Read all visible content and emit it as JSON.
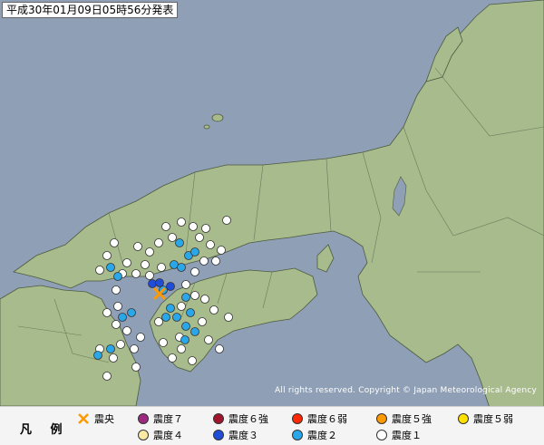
{
  "header": {
    "title": "平成30年01月09日05時56分発表"
  },
  "copyright": "All rights reserved. Copyright © Japan Meteorological Agency",
  "legend": {
    "title": "凡 例",
    "epicenter_label": "震央",
    "items": [
      {
        "label": "震度７",
        "color": "#9b2a80"
      },
      {
        "label": "震度６強",
        "color": "#a0142c"
      },
      {
        "label": "震度６弱",
        "color": "#ff2800"
      },
      {
        "label": "震度５強",
        "color": "#ff9900"
      },
      {
        "label": "震度５弱",
        "color": "#ffe100"
      },
      {
        "label": "震度４",
        "color": "#faeaa6"
      },
      {
        "label": "震度３",
        "color": "#1f4dd8"
      },
      {
        "label": "震度２",
        "color": "#2aa7e8"
      },
      {
        "label": "震度１",
        "color": "#ffffff"
      }
    ]
  },
  "colors": {
    "sea": "#8f9fb5",
    "land": "#a8bb8c",
    "epicenter": "#ff9900"
  }
}
